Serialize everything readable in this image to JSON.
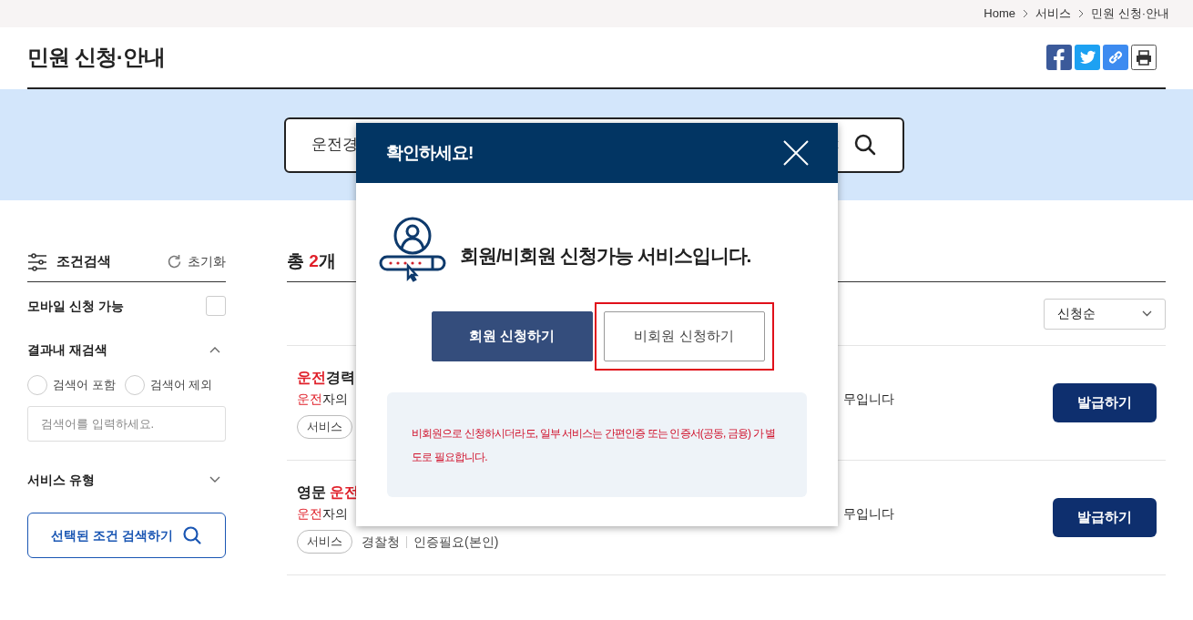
{
  "breadcrumb": [
    "Home",
    "서비스",
    "민원 신청·안내"
  ],
  "page_title": "민원 신청·안내",
  "share_buttons": [
    {
      "kind": "facebook"
    },
    {
      "kind": "twitter"
    },
    {
      "kind": "link"
    },
    {
      "kind": "print"
    }
  ],
  "search": {
    "value": "운전경"
  },
  "filter": {
    "title": "조건검색",
    "reset": "초기화",
    "mobile": {
      "label": "모바일 신청 가능",
      "checked": false
    },
    "refine": {
      "title": "결과내 재검색",
      "expanded": true,
      "options": [
        {
          "label": "검색어 포함",
          "selected": false
        },
        {
          "label": "검색어 제외",
          "selected": false
        }
      ],
      "placeholder": "검색어를 입력하세요."
    },
    "service_type": {
      "title": "서비스 유형",
      "expanded": false
    },
    "submit": "선택된 조건 검색하기"
  },
  "results": {
    "total_prefix": "총",
    "total_count": "2",
    "total_suffix": "개",
    "sort": "신청순",
    "items": [
      {
        "title": [
          {
            "text": "운전",
            "highlight": true
          },
          {
            "text": "경력",
            "highlight": false
          }
        ],
        "desc_left": [
          {
            "text": "운전",
            "highlight": true
          },
          {
            "text": "자의",
            "highlight": false
          }
        ],
        "desc_right": "무입니다",
        "tags": [
          {
            "text": "서비스",
            "kind": "chip"
          }
        ],
        "action": "발급하기"
      },
      {
        "title": [
          {
            "text": "영문 ",
            "highlight": false
          },
          {
            "text": "운전",
            "highlight": true
          }
        ],
        "desc_left": [
          {
            "text": "운전",
            "highlight": true
          },
          {
            "text": "자의",
            "highlight": false
          }
        ],
        "desc_right": "무입니다",
        "tags": [
          {
            "text": "서비스",
            "kind": "chip"
          },
          {
            "text": "경찰청",
            "kind": "plain"
          },
          {
            "text": "인증필요(본인)",
            "kind": "plain"
          }
        ],
        "action": "발급하기"
      }
    ]
  },
  "modal": {
    "title": "확인하세요!",
    "message": "회원/비회원 신청가능 서비스입니다.",
    "buttons": [
      {
        "label": "회원 신청하기",
        "kind": "primary",
        "highlighted": false
      },
      {
        "label": "비회원 신청하기",
        "kind": "secondary",
        "highlighted": true
      }
    ],
    "notice": "비회원으로 신청하시더라도, 일부 서비스는 간편인증 또는 인증서(공동, 금융) 가 별도로 필요합니다."
  }
}
